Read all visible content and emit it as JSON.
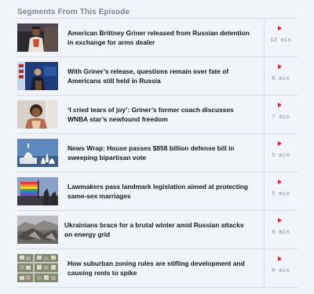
{
  "section": {
    "title": "Segments From This Episode"
  },
  "segments": [
    {
      "title": "American Brittney Griner released from Russian detention in exchange for arms dealer",
      "duration": "12 min",
      "thumb_icon": "basketball-player-thumbnail"
    },
    {
      "title": "With Griner’s release, questions remain over fate of Americans still held in Russia",
      "duration": "8 min",
      "thumb_icon": "briefing-room-thumbnail"
    },
    {
      "title": "‘I cried tears of joy’: Griner’s former coach discusses WNBA star’s newfound freedom",
      "duration": "7 min",
      "thumb_icon": "coach-portrait-thumbnail"
    },
    {
      "title": "News Wrap: House passes $858 billion defense bill in sweeping bipartisan vote",
      "duration": "5 min",
      "thumb_icon": "capitol-dome-thumbnail"
    },
    {
      "title": "Lawmakers pass landmark legislation aimed at protecting same-sex marriages",
      "duration": "5 min",
      "thumb_icon": "rainbow-flag-thumbnail"
    },
    {
      "title": "Ukrainians brace for a brutal winter amid Russian attacks on energy grid",
      "duration": "6 min",
      "thumb_icon": "damaged-building-thumbnail"
    },
    {
      "title": "How suburban zoning rules are stifling development and causing rents to spike",
      "duration": "8 min",
      "thumb_icon": "suburb-aerial-thumbnail"
    }
  ],
  "colors": {
    "accent": "#e1242b",
    "muted": "#7b8596",
    "divider": "#d6dbe4",
    "background": "#f1f4f9"
  }
}
